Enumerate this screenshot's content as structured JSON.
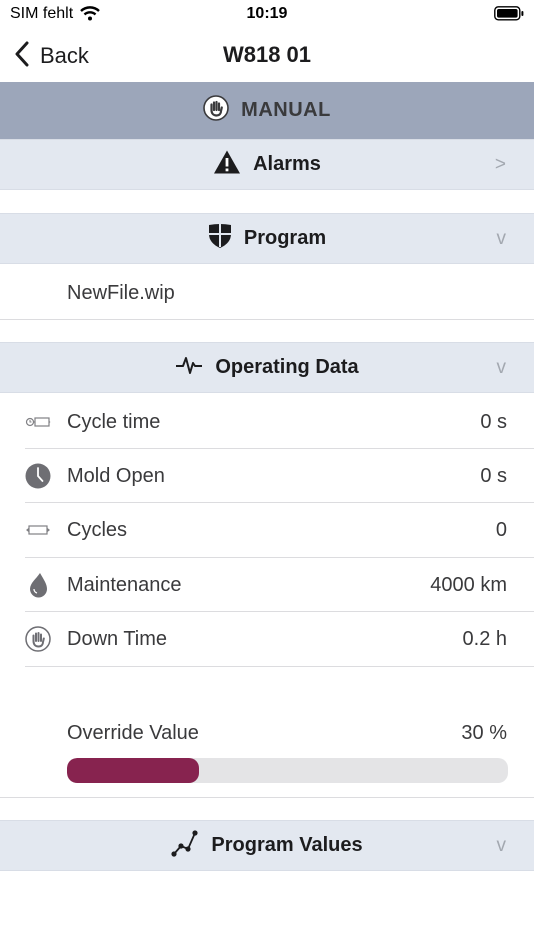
{
  "status_bar": {
    "carrier": "SIM fehlt",
    "time": "10:19"
  },
  "nav": {
    "back_label": "Back",
    "title": "W818 01"
  },
  "mode_banner": {
    "label": "MANUAL",
    "icon": "hand-icon"
  },
  "sections": {
    "alarms": {
      "title": "Alarms",
      "chevron": ">",
      "icon": "warning-icon"
    },
    "program": {
      "title": "Program",
      "chevron": "v",
      "icon": "shield-icon",
      "file": "NewFile.wip"
    },
    "operating_data": {
      "title": "Operating Data",
      "chevron": "v",
      "icon": "pulse-icon",
      "rows": [
        {
          "label": "Cycle time",
          "value": "0 s",
          "icon": "cycle-time-icon"
        },
        {
          "label": "Mold Open",
          "value": "0 s",
          "icon": "clock-icon"
        },
        {
          "label": "Cycles",
          "value": "0",
          "icon": "cycles-icon"
        },
        {
          "label": "Maintenance",
          "value": "4000 km",
          "icon": "drop-icon"
        },
        {
          "label": "Down Time",
          "value": "0.2 h",
          "icon": "hand-icon"
        }
      ],
      "override": {
        "label": "Override Value",
        "value": "30 %",
        "percent": 30
      }
    },
    "program_values": {
      "title": "Program Values",
      "chevron": "v",
      "icon": "graph-icon"
    }
  },
  "colors": {
    "accent": "#87234f",
    "banner": "#9ca6ba",
    "section_bg": "#e3e8f0"
  }
}
